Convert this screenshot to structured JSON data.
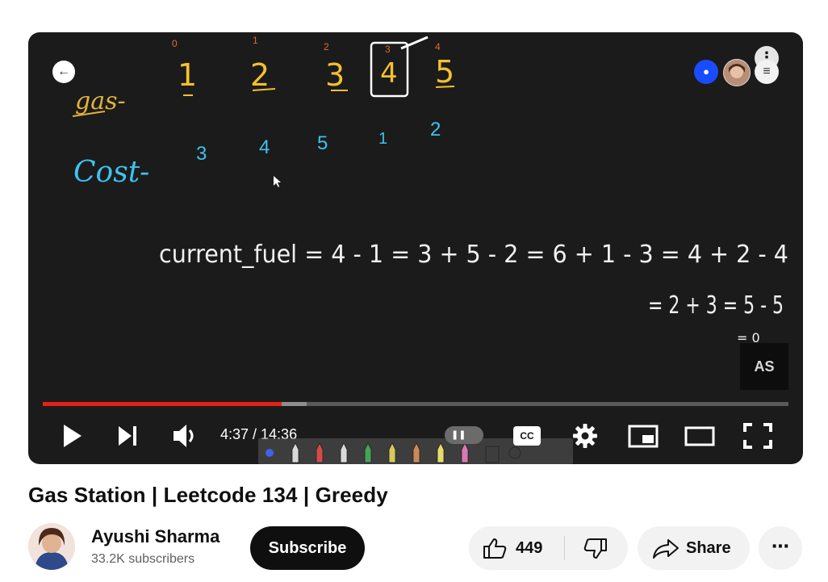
{
  "player": {
    "board": {
      "gas_label": "gas-",
      "cost_label": "Cost-",
      "gas_indices": [
        "0",
        "1",
        "2",
        "3",
        "4"
      ],
      "gas_values": [
        "1",
        "2",
        "3",
        "4",
        "5"
      ],
      "cost_values": [
        "3",
        "4",
        "5",
        "1",
        "2"
      ],
      "equation_line1": "current_fuel = 4 - 1 = 3 + 5 - 2 = 6 + 1 - 3 = 4 + 2 - 4",
      "equation_line2": "= 2 + 3 = 5 - 5",
      "equation_line3": "= 0"
    },
    "avatar_initials": "AS",
    "progress": {
      "played": 0.32,
      "buffered": 0.354
    },
    "time": "4:37 / 14:36",
    "cc_label": "CC"
  },
  "video": {
    "title": "Gas Station | Leetcode 134 | Greedy"
  },
  "channel": {
    "name": "Ayushi Sharma",
    "subscribers": "33.2K subscribers",
    "subscribe_label": "Subscribe"
  },
  "actions": {
    "like_count": "449",
    "share_label": "Share"
  }
}
